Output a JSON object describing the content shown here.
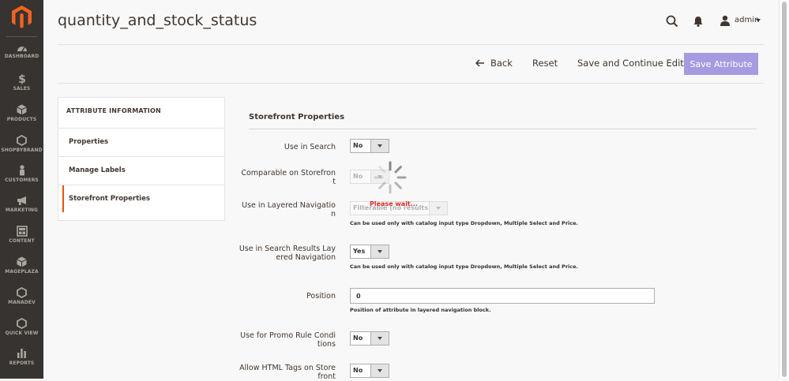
{
  "page": {
    "title": "quantity_and_stock_status"
  },
  "header": {
    "user": "admin"
  },
  "sidebar": {
    "items": [
      {
        "label": "DASHBOARD",
        "icon": "dashboard-icon"
      },
      {
        "label": "SALES",
        "icon": "dollar-icon"
      },
      {
        "label": "PRODUCTS",
        "icon": "cube-icon"
      },
      {
        "label": "SHOPBYBRAND",
        "icon": "hexagon-icon"
      },
      {
        "label": "CUSTOMERS",
        "icon": "person-icon"
      },
      {
        "label": "MARKETING",
        "icon": "megaphone-icon"
      },
      {
        "label": "CONTENT",
        "icon": "content-icon"
      },
      {
        "label": "MAGEPLAZA",
        "icon": "cube-icon"
      },
      {
        "label": "MANADEV",
        "icon": "hexagon-icon"
      },
      {
        "label": "QUICK VIEW",
        "icon": "hexagon-icon"
      },
      {
        "label": "REPORTS",
        "icon": "bars-icon"
      }
    ]
  },
  "actions": {
    "back": "Back",
    "reset": "Reset",
    "save_continue": "Save and Continue Edit",
    "save": "Save Attribute"
  },
  "tabs": {
    "header": "ATTRIBUTE INFORMATION",
    "items": [
      {
        "label": "Properties"
      },
      {
        "label": "Manage Labels"
      },
      {
        "label": "Storefront Properties"
      }
    ]
  },
  "form": {
    "section": "Storefront Properties",
    "use_in_search": {
      "label": "Use in Search",
      "value": "No"
    },
    "comparable": {
      "label1": "Comparable on Storefron",
      "label2": "t",
      "value": "No"
    },
    "layered_nav": {
      "label1": "Use in Layered Navigatio",
      "label2": "n",
      "value": "Filterable (no results)",
      "note": "Can be used only with catalog input type Dropdown, Multiple Select and Price."
    },
    "search_layered": {
      "label1": "Use in Search Results Lay",
      "label2": "ered Navigation",
      "value": "Yes",
      "note": "Can be used only with catalog input type Dropdown, Multiple Select and Price."
    },
    "position": {
      "label": "Position",
      "value": "0",
      "note": "Position of attribute in layered navigation block."
    },
    "promo": {
      "label1": "Use for Promo Rule Condi",
      "label2": "tions",
      "value": "No"
    },
    "html_tags": {
      "label1": "Allow HTML Tags on Store",
      "label2": "front",
      "value": "No"
    }
  },
  "loader": {
    "text": "Please wait..."
  }
}
